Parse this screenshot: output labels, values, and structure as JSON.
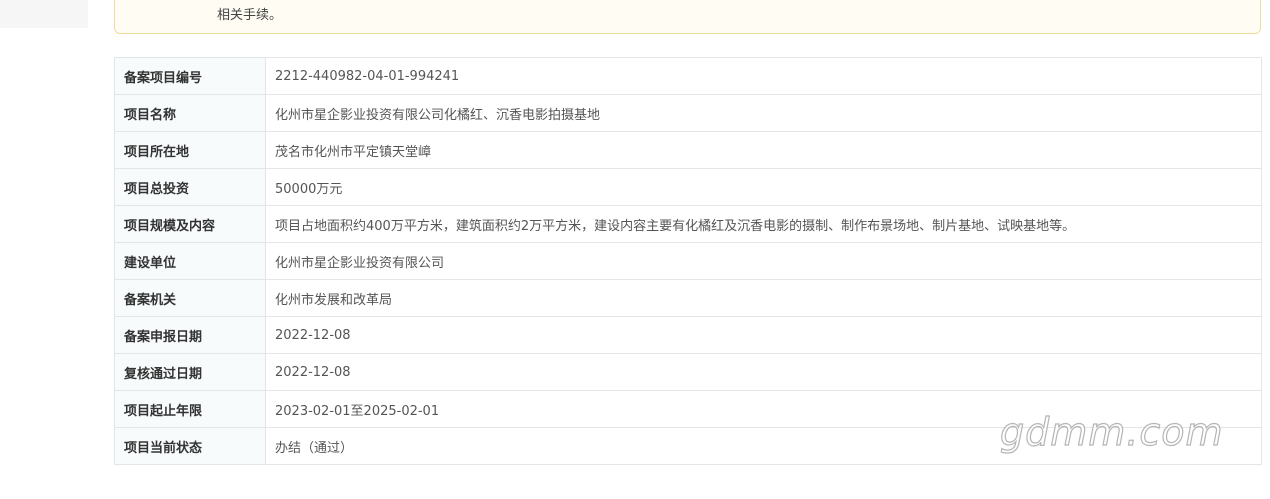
{
  "notice": {
    "text": "相关手续。"
  },
  "rows": [
    {
      "label": "备案项目编号",
      "value": "2212-440982-04-01-994241"
    },
    {
      "label": "项目名称",
      "value": "化州市星企影业投资有限公司化橘红、沉香电影拍摄基地"
    },
    {
      "label": "项目所在地",
      "value": "茂名市化州市平定镇天堂嶂"
    },
    {
      "label": "项目总投资",
      "value": "50000万元"
    },
    {
      "label": "项目规模及内容",
      "value": "项目占地面积约400万平方米，建筑面积约2万平方米，建设内容主要有化橘红及沉香电影的摄制、制作布景场地、制片基地、试映基地等。"
    },
    {
      "label": "建设单位",
      "value": "化州市星企影业投资有限公司"
    },
    {
      "label": "备案机关",
      "value": "化州市发展和改革局"
    },
    {
      "label": "备案申报日期",
      "value": "2022-12-08"
    },
    {
      "label": "复核通过日期",
      "value": "2022-12-08"
    },
    {
      "label": "项目起止年限",
      "value": "2023-02-01至2025-02-01"
    },
    {
      "label": "项目当前状态",
      "value": "办结（通过）"
    }
  ],
  "watermark": {
    "text": "gdmm.com"
  }
}
